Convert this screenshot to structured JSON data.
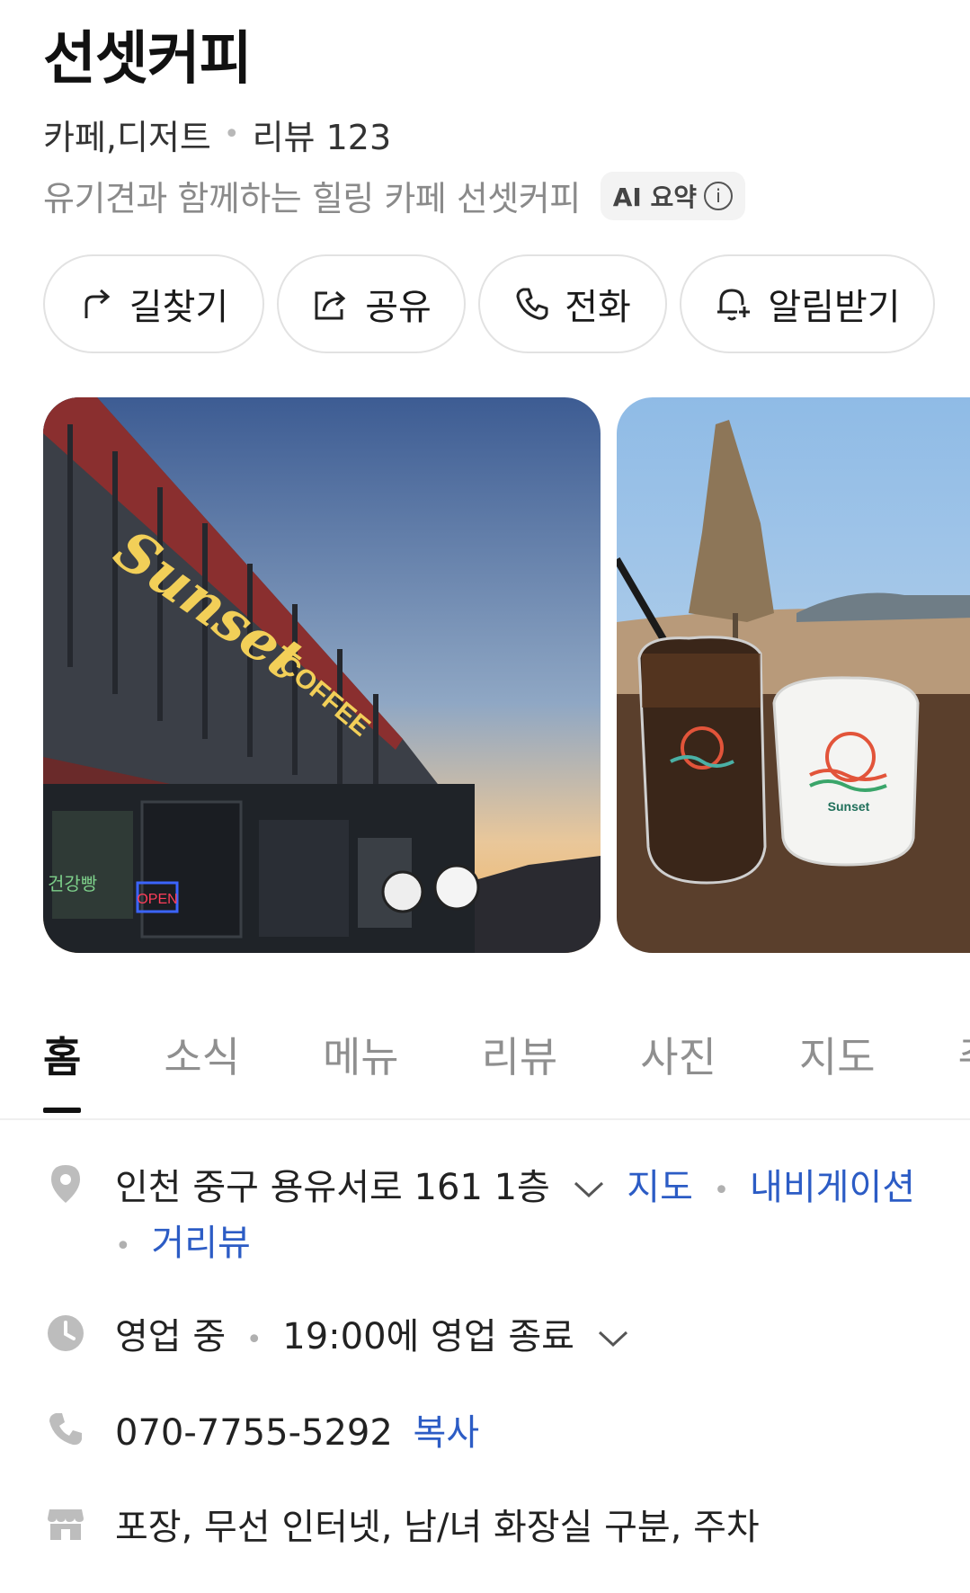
{
  "place": {
    "name": "선셋커피",
    "category": "카페,디저트",
    "review_label": "리뷰 123",
    "summary": "유기견과 함께하는 힐링 카페 선셋커피",
    "ai_badge": "AI 요약",
    "info_glyph": "i"
  },
  "actions": {
    "route": "길찾기",
    "share": "공유",
    "call": "전화",
    "alert": "알림받기"
  },
  "photos": {
    "photo1_sign": "Sunset",
    "photo1_sign_sub": "COFFEE",
    "photo1_open": "OPEN",
    "photo1_window": "건강빵",
    "photo2_cup": "Sunset"
  },
  "tabs": [
    "홈",
    "소식",
    "메뉴",
    "리뷰",
    "사진",
    "지도",
    "주"
  ],
  "info": {
    "address": "인천 중구 용유서로 161 1층",
    "map_link": "지도",
    "navigation_link": "내비게이션",
    "streetview_link": "거리뷰",
    "status": "영업 중",
    "hours": "19:00에 영업 종료",
    "phone": "070-7755-5292",
    "copy_label": "복사",
    "amenities": "포장, 무선 인터넷, 남/녀 화장실 구분, 주차"
  },
  "colors": {
    "link": "#2c5cc5",
    "muted": "#8a8a8a",
    "icon_gray": "#bdbdbd"
  }
}
